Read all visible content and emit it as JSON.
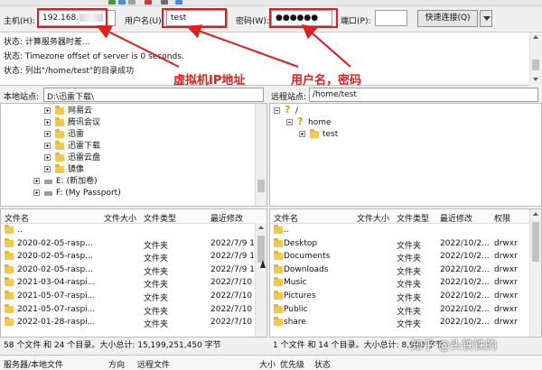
{
  "quickconnect": {
    "host_label": "主机(H):",
    "host_value": "192.168.",
    "user_label": "用户名(U):",
    "user_value": "test",
    "pass_label": "密码(W):",
    "pass_value": "●●●●●●",
    "port_label": "端口(P):",
    "port_value": "",
    "connect_label": "快速连接(Q)"
  },
  "log": [
    {
      "label": "状态:",
      "text": "计算服务器时差..."
    },
    {
      "label": "状态:",
      "text": "Timezone offset of server is 0 seconds."
    },
    {
      "label": "状态:",
      "text": "列出\"/home/test\"的目录成功"
    }
  ],
  "annotations": {
    "host": "虚拟机IP地址",
    "user": "用户名，密码"
  },
  "local": {
    "path_label": "本地站点:",
    "path_value": "D:\\迅雷下载\\",
    "tree": [
      {
        "label": "网易云",
        "kind": "folder"
      },
      {
        "label": "腾讯会议",
        "kind": "folder"
      },
      {
        "label": "迅雷",
        "kind": "folder"
      },
      {
        "label": "迅雷下载",
        "kind": "folder"
      },
      {
        "label": "迅雷云盘",
        "kind": "folder"
      },
      {
        "label": "镜像",
        "kind": "folder"
      },
      {
        "label": "E: (新加卷)",
        "kind": "drive"
      },
      {
        "label": "F: (My Passport)",
        "kind": "drive"
      }
    ],
    "columns": [
      "文件名",
      "文件大小",
      "文件类型",
      "最近修改"
    ],
    "rows": [
      {
        "name": "..",
        "size": "",
        "type": "",
        "modified": ""
      },
      {
        "name": "2020-02-05-rasp...",
        "size": "",
        "type": "文件夹",
        "modified": "2022/7/9 1"
      },
      {
        "name": "2020-02-05-rasp...",
        "size": "",
        "type": "文件夹",
        "modified": "2022/7/9 1"
      },
      {
        "name": "2020-02-05-rasp...",
        "size": "",
        "type": "文件夹",
        "modified": "2022/7/9 1"
      },
      {
        "name": "2021-03-04-raspi...",
        "size": "",
        "type": "文件夹",
        "modified": "2022/7/10"
      },
      {
        "name": "2021-05-07-raspi...",
        "size": "",
        "type": "文件夹",
        "modified": "2022/7/10"
      },
      {
        "name": "2021-05-07-raspi...",
        "size": "",
        "type": "文件夹",
        "modified": "2022/7/10"
      },
      {
        "name": "2022-01-28-raspi...",
        "size": "",
        "type": "文件夹",
        "modified": "2022/7/10"
      }
    ],
    "status": "58 个文件 和 24 个目录。大小总计: 15,199,251,450 字节"
  },
  "remote": {
    "path_label": "远程站点:",
    "path_value": "/home/test",
    "tree": [
      {
        "label": "/",
        "kind": "unknown"
      },
      {
        "label": "home",
        "kind": "unknown"
      },
      {
        "label": "test",
        "kind": "folder"
      }
    ],
    "columns": [
      "文件名",
      "文件大小",
      "文件类型",
      "最近修改",
      "权限"
    ],
    "rows": [
      {
        "name": "..",
        "size": "",
        "type": "",
        "modified": "",
        "perm": ""
      },
      {
        "name": "Desktop",
        "size": "",
        "type": "文件夹",
        "modified": "2022/10/2...",
        "perm": "drwxr"
      },
      {
        "name": "Documents",
        "size": "",
        "type": "文件夹",
        "modified": "2022/10/2...",
        "perm": "drwxr"
      },
      {
        "name": "Downloads",
        "size": "",
        "type": "文件夹",
        "modified": "2022/10/2...",
        "perm": "drwxr"
      },
      {
        "name": "Music",
        "size": "",
        "type": "文件夹",
        "modified": "2022/10/2...",
        "perm": "drwxr"
      },
      {
        "name": "Pictures",
        "size": "",
        "type": "文件夹",
        "modified": "2022/10/2...",
        "perm": "drwxr"
      },
      {
        "name": "Public",
        "size": "",
        "type": "文件夹",
        "modified": "2022/10/2...",
        "perm": "drwxr"
      },
      {
        "name": "share",
        "size": "",
        "type": "文件夹",
        "modified": "2022/10/2...",
        "perm": "drwxr"
      }
    ],
    "status": "1 个文件 和 14 个目录。大小总计: 8,980 字节"
  },
  "queue": {
    "columns": [
      "服务器/本地文件",
      "方向",
      "远程文件",
      "大小",
      "优先级",
      "状态"
    ]
  },
  "watermark": "知乎 @头铁铁的",
  "colors": {
    "annotation": "#e51c1c",
    "folder": "#f3c84d"
  }
}
